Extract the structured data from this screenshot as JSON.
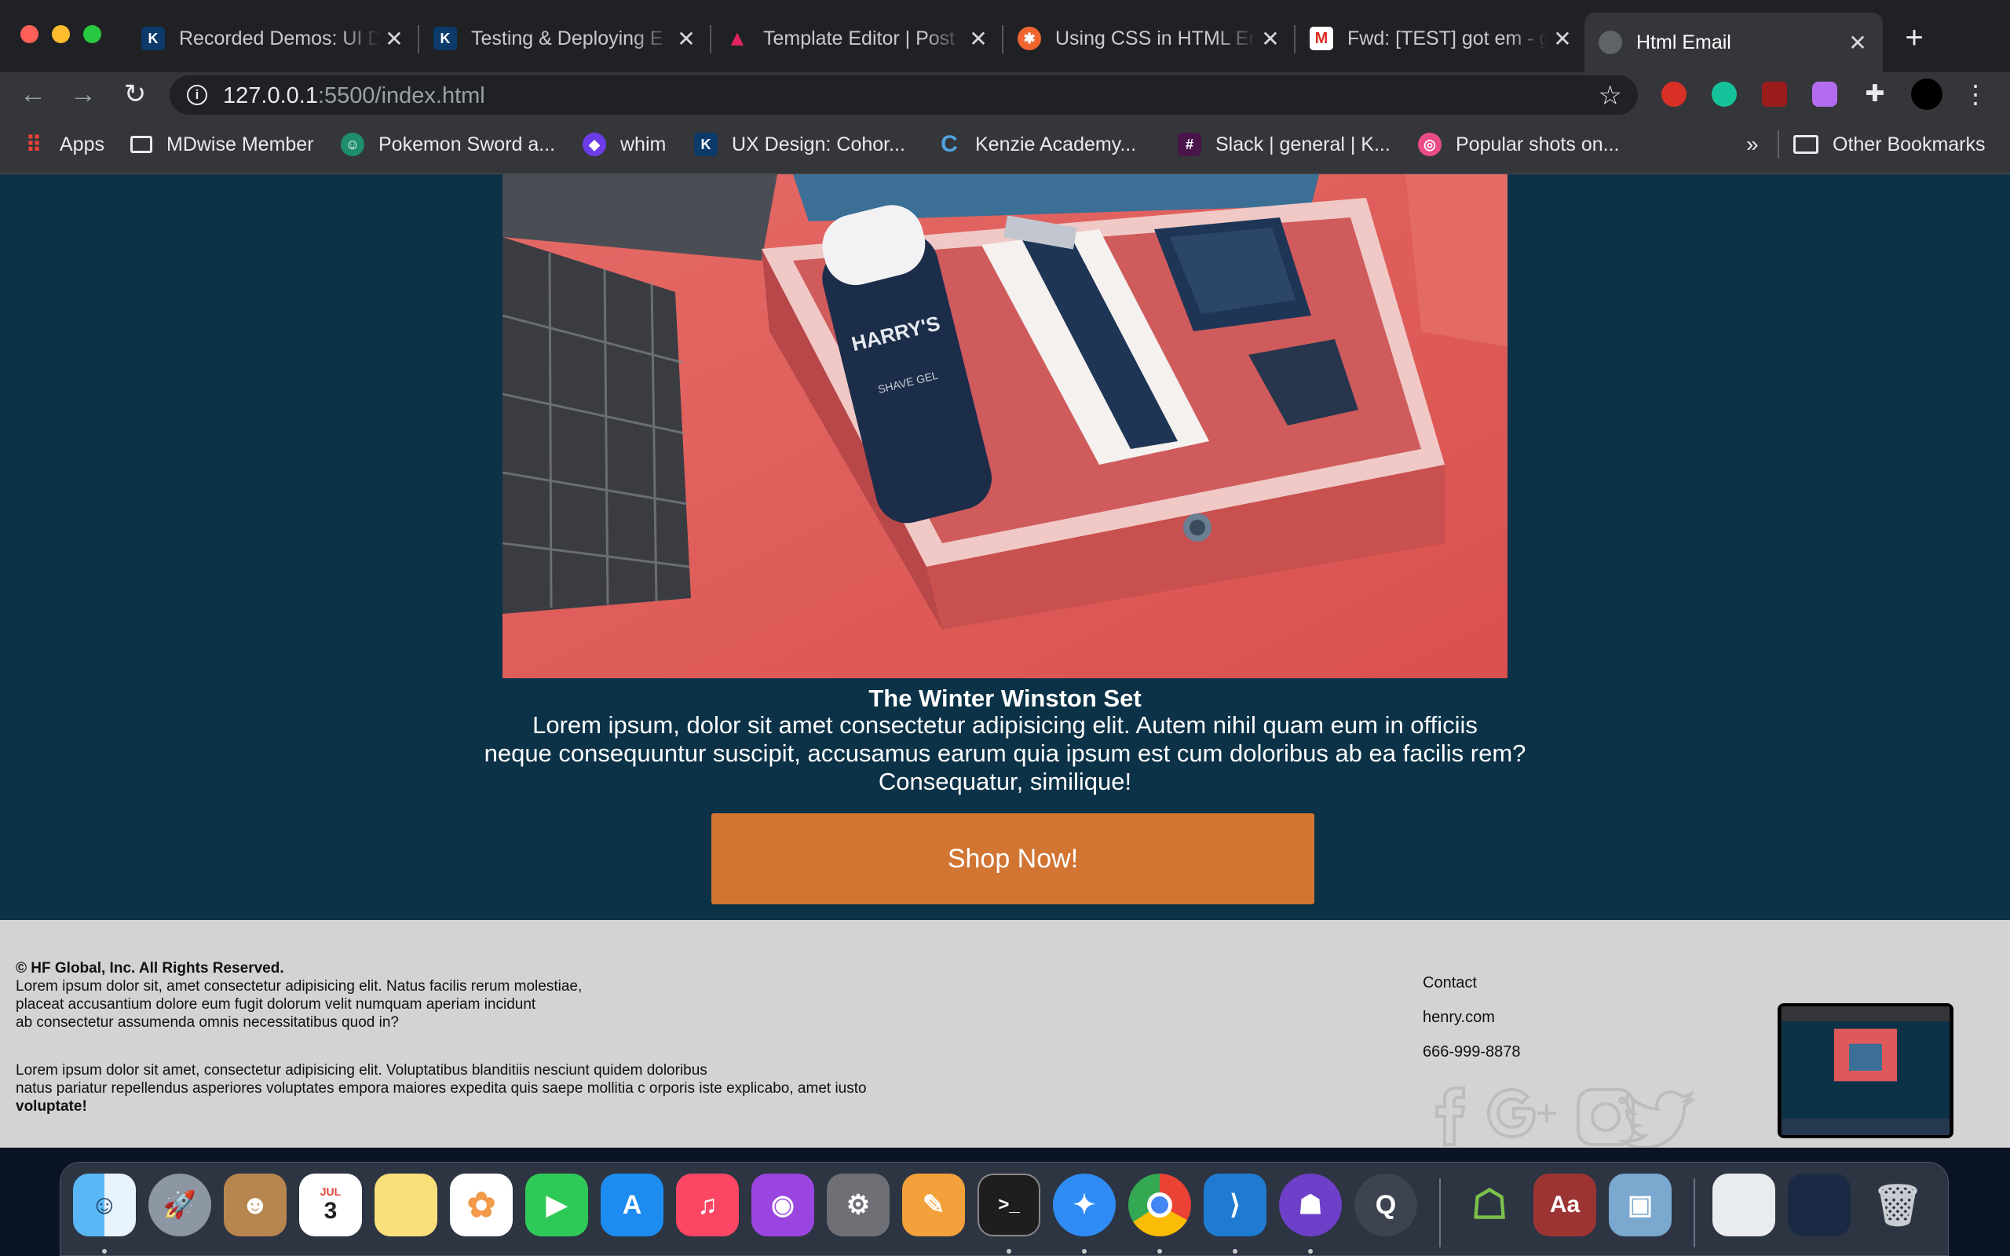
{
  "browser": {
    "tabs": [
      {
        "title": "Recorded Demos: UI D",
        "favicon": "ka-icon",
        "color": "#0b3a6b"
      },
      {
        "title": "Testing & Deploying E",
        "favicon": "ka-icon",
        "color": "#0b3a6b"
      },
      {
        "title": "Template Editor | Post",
        "favicon": "postmark-icon",
        "color": "#e0245e"
      },
      {
        "title": "Using CSS in HTML Em",
        "favicon": "litmus-icon",
        "color": "#f0652f"
      },
      {
        "title": "Fwd: [TEST] got em - g",
        "favicon": "gmail-icon",
        "color": "#ffffff"
      },
      {
        "title": "Html Email",
        "favicon": "globe-icon",
        "color": "#5f6368"
      }
    ],
    "url_host": "127.0.0.1",
    "url_rest": ":5500/index.html",
    "bookmarks": [
      {
        "label": "Apps",
        "icon": "apps-grid-icon"
      },
      {
        "label": "MDwise Member",
        "icon": "monitor-icon"
      },
      {
        "label": "Pokemon Sword a...",
        "icon": "chat-icon"
      },
      {
        "label": "whim",
        "icon": "whim-icon"
      },
      {
        "label": "UX Design: Cohor...",
        "icon": "ka-icon"
      },
      {
        "label": "Kenzie Academy...",
        "icon": "c-icon"
      },
      {
        "label": "Slack | general | K...",
        "icon": "slack-icon"
      },
      {
        "label": "Popular shots on...",
        "icon": "dribbble-icon"
      }
    ],
    "more_bookmarks": "»",
    "other_bookmarks": "Other Bookmarks"
  },
  "email": {
    "product_title": "The Winter Winston Set",
    "product_desc_line1": "Lorem ipsum, dolor sit amet consectetur adipisicing elit. Autem nihil quam eum in officiis",
    "product_desc_line2": "neque consequuntur suscipit, accusamus earum quia ipsum est cum doloribus ab ea facilis rem?",
    "product_desc_line3": "Consequatur, similique!",
    "cta_label": "Shop Now!",
    "image_text": "HARRY'S",
    "image_text2": "SHAVE GEL",
    "hero_bg": "#0c3247",
    "cta_color": "#d27533"
  },
  "footer": {
    "copyright": "© HF Global, Inc. All Rights Reserved.",
    "para1_line1": "Lorem ipsum dolor sit, amet consectetur adipisicing elit. Natus facilis rerum molestiae,",
    "para1_line2": "placeat accusantium dolore eum fugit dolorum velit numquam aperiam incidunt",
    "para1_line3": "ab consectetur assumenda omnis necessitatibus quod in?",
    "para2_line1": "Lorem ipsum dolor sit amet, consectetur adipisicing elit. Voluptatibus blanditiis nesciunt quidem doloribus",
    "para2_line2": "natus pariatur repellendus asperiores voluptates empora maiores expedita quis saepe mollitia c orporis iste explicabo, amet iusto",
    "para2_line3": "voluptate!",
    "contact_heading": "Contact",
    "contact_site": "henry.com",
    "contact_phone": "666-999-8878",
    "socials": [
      "facebook-icon",
      "google-plus-icon",
      "instagram-icon",
      "twitter-icon"
    ]
  },
  "dock": {
    "apps": [
      "finder",
      "launchpad",
      "contacts",
      "calendar",
      "notes",
      "photos",
      "facetime",
      "app-store",
      "music",
      "podcasts",
      "system-preferences",
      "pages",
      "terminal",
      "safari",
      "chrome",
      "vscode",
      "github-desktop",
      "quicktime",
      "android-studio",
      "dictionary",
      "preview",
      "downloads-stack",
      "vscode-window",
      "trash"
    ],
    "calendar_month": "JUL",
    "calendar_day": "3",
    "dictionary_label": "Aa",
    "terminal_label": ">_"
  }
}
